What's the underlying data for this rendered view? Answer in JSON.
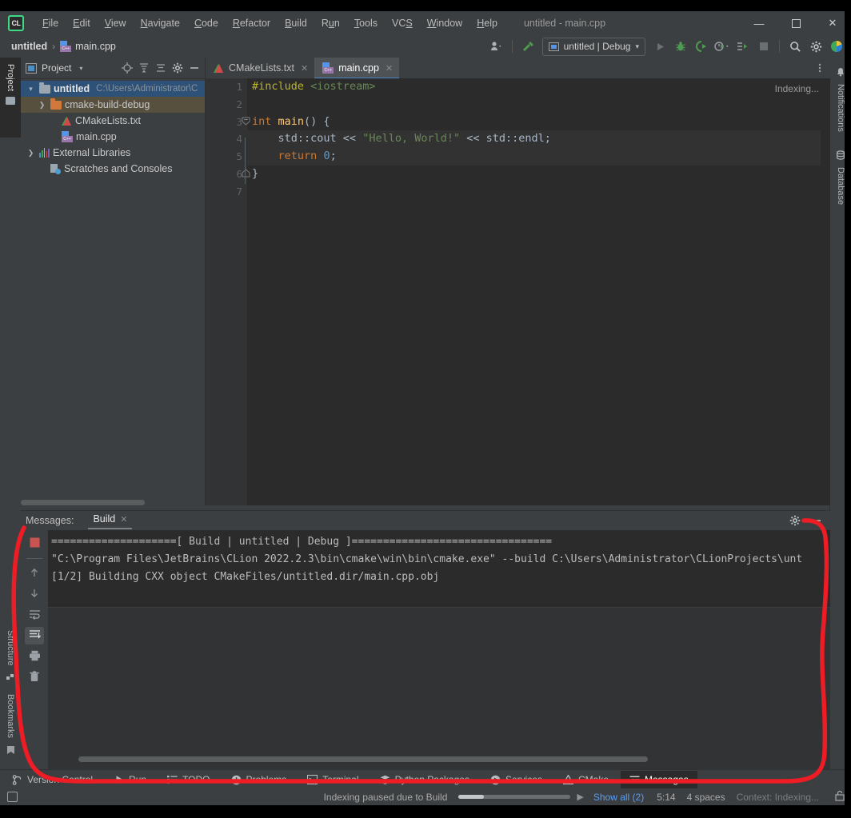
{
  "window": {
    "title": "untitled - main.cpp",
    "logo_text": "CL",
    "controls": {
      "minimize": "—",
      "maximize": "☐",
      "close": "✕"
    }
  },
  "menubar": {
    "items": [
      {
        "label": "File",
        "mnemonic": "F"
      },
      {
        "label": "Edit",
        "mnemonic": "E"
      },
      {
        "label": "View",
        "mnemonic": "V"
      },
      {
        "label": "Navigate",
        "mnemonic": "N"
      },
      {
        "label": "Code",
        "mnemonic": "C"
      },
      {
        "label": "Refactor",
        "mnemonic": "R"
      },
      {
        "label": "Build",
        "mnemonic": "B"
      },
      {
        "label": "Run",
        "mnemonic": "u"
      },
      {
        "label": "Tools",
        "mnemonic": "T"
      },
      {
        "label": "VCS",
        "mnemonic": "S"
      },
      {
        "label": "Window",
        "mnemonic": "W"
      },
      {
        "label": "Help",
        "mnemonic": "H"
      }
    ]
  },
  "navbar": {
    "breadcrumb": {
      "root": "untitled",
      "separator": "›",
      "file": "main.cpp"
    },
    "toolbar": {
      "profiler_icon": "user-profiler-icon",
      "build_icon": "hammer-icon",
      "run_config": {
        "label": "untitled | Debug",
        "icon": "run-config-icon",
        "chevron": "▾"
      },
      "run_icon": "run-icon",
      "debug_icon": "debug-icon",
      "run_with_coverage_icon": "run-coverage-icon",
      "profile_icon": "profile-icon",
      "attach_icon": "attach-process-icon",
      "stop_icon": "stop-icon",
      "search_icon": "search-everywhere-icon",
      "settings_icon": "settings-gear-icon",
      "updates_icon": "ide-updates-icon"
    }
  },
  "left_stripe": {
    "tabs": [
      {
        "label": "Project",
        "icon": "project-folder-icon",
        "active": true
      },
      {
        "label": "Structure",
        "icon": "structure-icon",
        "active": false
      },
      {
        "label": "Bookmarks",
        "icon": "bookmarks-icon",
        "active": false
      }
    ]
  },
  "right_stripe": {
    "tabs": [
      {
        "label": "Notifications",
        "icon": "bell-icon"
      },
      {
        "label": "Database",
        "icon": "database-icon"
      }
    ]
  },
  "project_window": {
    "title": "Project",
    "header_icons": [
      "chevron-down-icon",
      "locate-target-icon",
      "expand-all-icon",
      "collapse-all-icon",
      "gear-icon",
      "hide-icon"
    ],
    "tree": [
      {
        "arrow": "⌄",
        "label": "untitled",
        "path": "C:\\Users\\Administrator\\C",
        "icon": "folder-icon",
        "state": "root-selected",
        "indent": 0
      },
      {
        "arrow": "›",
        "label": "cmake-build-debug",
        "path": "",
        "icon": "folder-orange-icon",
        "state": "highlighted",
        "indent": 1
      },
      {
        "arrow": "",
        "label": "CMakeLists.txt",
        "path": "",
        "icon": "cmake-file-icon",
        "state": "",
        "indent": 2
      },
      {
        "arrow": "",
        "label": "main.cpp",
        "path": "",
        "icon": "cpp-file-icon",
        "state": "",
        "indent": 2
      },
      {
        "arrow": "›",
        "label": "External Libraries",
        "path": "",
        "icon": "libraries-icon",
        "state": "",
        "indent": 0
      },
      {
        "arrow": "",
        "label": "Scratches and Consoles",
        "path": "",
        "icon": "scratches-icon",
        "state": "",
        "indent": 1
      }
    ]
  },
  "editor": {
    "tabs": [
      {
        "label": "CMakeLists.txt",
        "icon": "cmake-file-icon",
        "close": "✕",
        "active": false
      },
      {
        "label": "main.cpp",
        "icon": "cpp-file-icon",
        "close": "✕",
        "active": true
      }
    ],
    "tab_overflow_icon": "more-vertical-icon",
    "status_hint": "Indexing...",
    "line_numbers": [
      "1",
      "2",
      "3",
      "4",
      "5",
      "6",
      "7"
    ],
    "code": [
      {
        "n": 1,
        "tokens": [
          {
            "t": "#include",
            "c": "c-pp"
          },
          {
            "t": " ",
            "c": ""
          },
          {
            "t": "<iostream>",
            "c": "c-inc"
          }
        ],
        "current": false,
        "fold": ""
      },
      {
        "n": 2,
        "tokens": [],
        "current": false,
        "fold": ""
      },
      {
        "n": 3,
        "tokens": [
          {
            "t": "int",
            "c": "c-kw"
          },
          {
            "t": " ",
            "c": ""
          },
          {
            "t": "main",
            "c": "c-fn"
          },
          {
            "t": "() {",
            "c": "c-id"
          }
        ],
        "current": false,
        "fold": "minus-top"
      },
      {
        "n": 4,
        "tokens": [
          {
            "t": "    std::cout ",
            "c": "c-id"
          },
          {
            "t": "<< ",
            "c": "c-id"
          },
          {
            "t": "\"Hello, World!\"",
            "c": "c-str"
          },
          {
            "t": " << std::endl;",
            "c": "c-id"
          }
        ],
        "current": true,
        "fold": ""
      },
      {
        "n": 5,
        "tokens": [
          {
            "t": "    ",
            "c": ""
          },
          {
            "t": "return",
            "c": "c-kw"
          },
          {
            "t": " ",
            "c": ""
          },
          {
            "t": "0",
            "c": "c-num"
          },
          {
            "t": ";",
            "c": "c-id"
          }
        ],
        "current": true,
        "fold": ""
      },
      {
        "n": 6,
        "tokens": [
          {
            "t": "}",
            "c": "c-id"
          }
        ],
        "current": false,
        "fold": "minus-bottom"
      },
      {
        "n": 7,
        "tokens": [],
        "current": false,
        "fold": ""
      }
    ]
  },
  "messages_window": {
    "label": "Messages:",
    "tab": {
      "label": "Build",
      "close": "✕"
    },
    "header_icons": [
      "gear-icon",
      "minimize-icon"
    ],
    "sidebar_buttons": [
      {
        "icon": "stop-red-icon",
        "name": "stop-build-button",
        "active": false
      },
      {
        "icon": "arrow-up-icon",
        "name": "previous-problem-button",
        "active": false
      },
      {
        "icon": "arrow-down-icon",
        "name": "next-problem-button",
        "active": false
      },
      {
        "icon": "soft-wrap-icon",
        "name": "soft-wrap-button",
        "active": false
      },
      {
        "icon": "scroll-to-end-icon",
        "name": "scroll-to-end-button",
        "active": true
      },
      {
        "icon": "print-icon",
        "name": "print-button",
        "active": false
      },
      {
        "icon": "trash-icon",
        "name": "clear-all-button",
        "active": false
      }
    ],
    "output": [
      "====================[ Build | untitled | Debug ]================================",
      "\"C:\\Program Files\\JetBrains\\CLion 2022.2.3\\bin\\cmake\\win\\bin\\cmake.exe\" --build C:\\Users\\Administrator\\CLionProjects\\unt",
      "[1/2] Building CXX object CMakeFiles/untitled.dir/main.cpp.obj"
    ]
  },
  "bottom_bar": {
    "buttons": [
      {
        "label": "Version Control",
        "icon": "branch-icon",
        "active": false
      },
      {
        "label": "Run",
        "icon": "run-triangle-icon",
        "active": false
      },
      {
        "label": "TODO",
        "icon": "todo-list-icon",
        "active": false
      },
      {
        "label": "Problems",
        "icon": "problems-icon",
        "active": false
      },
      {
        "label": "Terminal",
        "icon": "terminal-icon",
        "active": false
      },
      {
        "label": "Python Packages",
        "icon": "python-packages-icon",
        "active": false
      },
      {
        "label": "Services",
        "icon": "services-icon",
        "active": false
      },
      {
        "label": "CMake",
        "icon": "cmake-icon",
        "active": false
      },
      {
        "label": "Messages",
        "icon": "messages-icon",
        "active": true
      }
    ]
  },
  "status_bar": {
    "toggle_icon": "toggle-toolwindows-icon",
    "indexing_text": "Indexing paused due to Build",
    "resume_icon": "resume-icon",
    "show_all": "Show all (2)",
    "caret_position": "5:14",
    "indent": "4 spaces",
    "context": "Context: Indexing...",
    "lock_icon": "lock-icon"
  },
  "annotation": {
    "color": "#ee1c24",
    "shape": "hand-drawn-oval-around-messages-panel"
  }
}
